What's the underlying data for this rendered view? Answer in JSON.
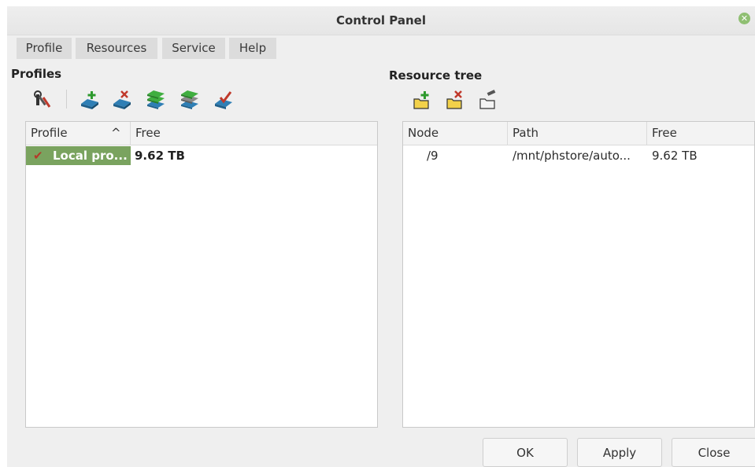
{
  "window": {
    "title": "Control Panel"
  },
  "menubar": {
    "items": [
      "Profile",
      "Resources",
      "Service",
      "Help"
    ]
  },
  "profiles": {
    "title": "Profiles",
    "toolbar": [
      "settings-tools-icon",
      "add-disk-icon",
      "remove-disk-icon",
      "green-disks-icon",
      "gray-disks-icon",
      "check-disk-icon"
    ],
    "columns": {
      "profile": "Profile",
      "sort_indicator": "^",
      "free": "Free"
    },
    "rows": [
      {
        "check": "✔",
        "profile": "Local pro...",
        "free": "9.62 TB"
      }
    ]
  },
  "resources": {
    "title": "Resource tree",
    "toolbar": [
      "add-folder-icon",
      "remove-folder-icon",
      "edit-folder-icon"
    ],
    "columns": {
      "node": "Node",
      "path": "Path",
      "free": "Free"
    },
    "rows": [
      {
        "node": "/9",
        "path": "/mnt/phstore/auto...",
        "free": "9.62 TB"
      }
    ]
  },
  "buttons": {
    "ok": "OK",
    "apply": "Apply",
    "close": "Close"
  },
  "colors": {
    "selected_row": "#7aa35f",
    "check_mark": "#b43a2a"
  }
}
